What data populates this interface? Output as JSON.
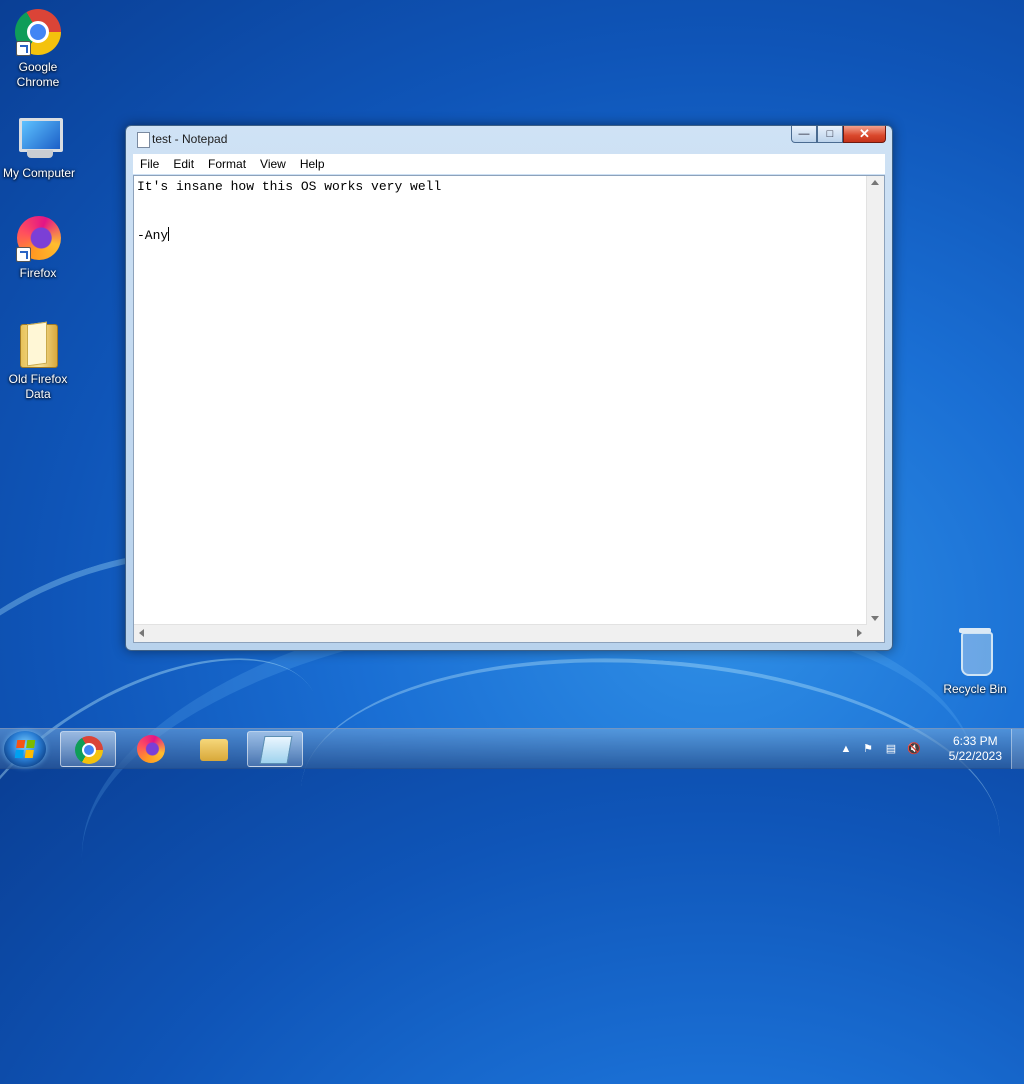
{
  "desktop": {
    "icons": [
      {
        "label": "Google Chrome"
      },
      {
        "label": "My Computer"
      },
      {
        "label": "Firefox"
      },
      {
        "label": "Old Firefox Data"
      },
      {
        "label": "Recycle Bin"
      }
    ]
  },
  "window": {
    "title": "test - Notepad",
    "menu": [
      "File",
      "Edit",
      "Format",
      "View",
      "Help"
    ],
    "content": {
      "line1": "It's insane how this OS works very well",
      "line2": "-Any"
    }
  },
  "taskbar": {
    "apps": [
      "chrome",
      "firefox",
      "file-explorer",
      "notepad"
    ],
    "active_app": "notepad"
  },
  "tray": {
    "time": "6:33 PM",
    "date": "5/22/2023"
  },
  "colors": {
    "accent": "#1a6fd4",
    "close_button": "#d9472b"
  }
}
